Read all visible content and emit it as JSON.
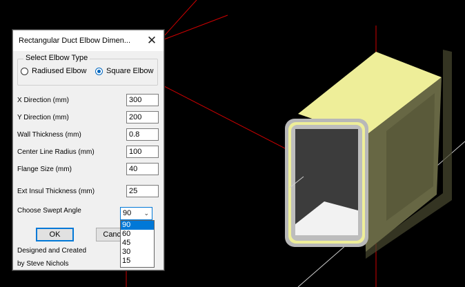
{
  "dialog": {
    "title": "Rectangular Duct Elbow Dimen...",
    "close_glyph": "✕",
    "elbow_group": {
      "legend": "Select Elbow Type",
      "options": [
        {
          "label": "Radiused Elbow",
          "selected": false
        },
        {
          "label": "Square Elbow",
          "selected": true
        }
      ]
    },
    "fields": [
      {
        "label": "X Direction (mm)",
        "value": "300"
      },
      {
        "label": "Y Direction (mm)",
        "value": "200"
      },
      {
        "label": "Wall Thickness (mm)",
        "value": "0.8"
      },
      {
        "label": "Center Line Radius (mm)",
        "value": "100"
      },
      {
        "label": "Flange Size (mm)",
        "value": "40"
      },
      {
        "label": "Ext Insul Thickness (mm)",
        "value": "25"
      }
    ],
    "swept_angle": {
      "label": "Choose Swept Angle",
      "value": "90",
      "options": [
        "90",
        "60",
        "45",
        "30",
        "15"
      ],
      "selected_option": "90"
    },
    "buttons": {
      "ok": "OK",
      "cancel": "Cancel"
    },
    "credit": [
      "Designed and Created",
      "by Steve Nichols"
    ]
  },
  "viewport": {
    "background": "#000000",
    "model_face_color": "#eeee99",
    "guide_line_color": "#d00000"
  }
}
